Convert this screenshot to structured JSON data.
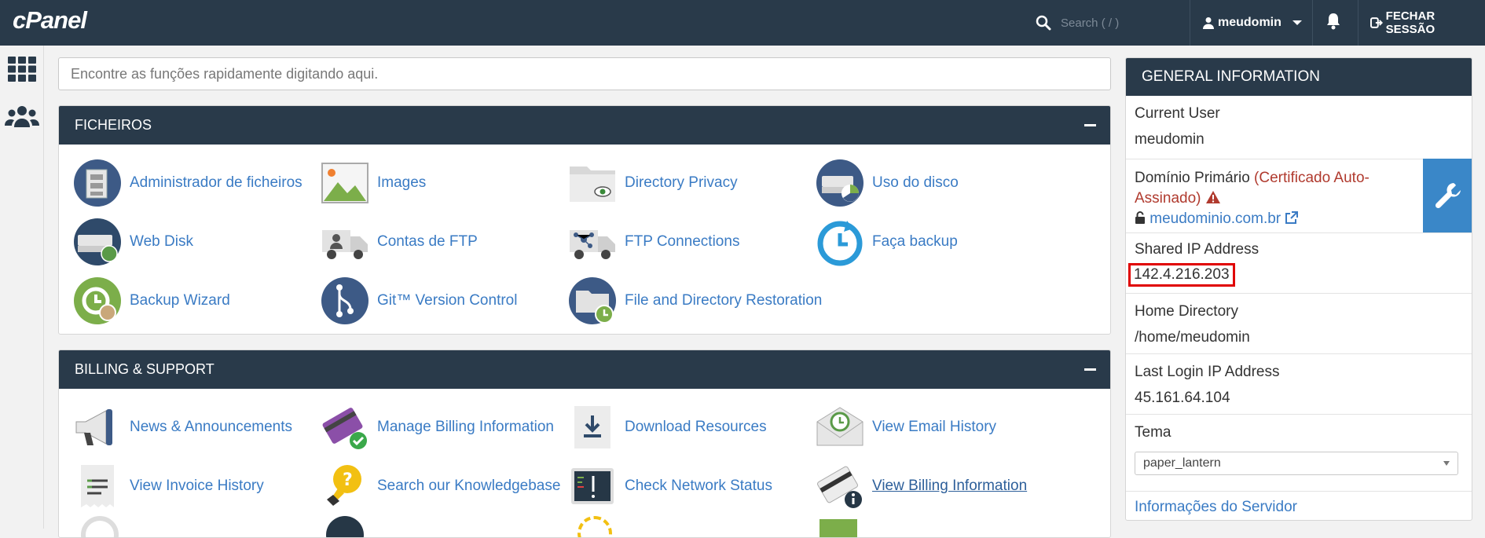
{
  "header": {
    "logo": "cPanel",
    "search_placeholder": "Search ( / )",
    "username": "meudomin",
    "logout": "FECHAR SESSÃO"
  },
  "quick_search": {
    "placeholder": "Encontre as funções rapidamente digitando aqui."
  },
  "panels": [
    {
      "title": "FICHEIROS",
      "items": [
        {
          "label": "Administrador de ficheiros",
          "icon": "file-manager-icon"
        },
        {
          "label": "Images",
          "icon": "images-icon"
        },
        {
          "label": "Directory Privacy",
          "icon": "directory-privacy-icon"
        },
        {
          "label": "Uso do disco",
          "icon": "disk-usage-icon"
        },
        {
          "label": "Web Disk",
          "icon": "web-disk-icon"
        },
        {
          "label": "Contas de FTP",
          "icon": "ftp-accounts-icon"
        },
        {
          "label": "FTP Connections",
          "icon": "ftp-connections-icon"
        },
        {
          "label": "Faça backup",
          "icon": "backup-icon"
        },
        {
          "label": "Backup Wizard",
          "icon": "backup-wizard-icon"
        },
        {
          "label": "Git™ Version Control",
          "icon": "git-icon"
        },
        {
          "label": "File and Directory Restoration",
          "icon": "restoration-icon"
        }
      ]
    },
    {
      "title": "BILLING & SUPPORT",
      "items": [
        {
          "label": "News & Announcements",
          "icon": "megaphone-icon"
        },
        {
          "label": "Manage Billing Information",
          "icon": "credit-card-icon"
        },
        {
          "label": "Download Resources",
          "icon": "download-icon"
        },
        {
          "label": "View Email History",
          "icon": "email-history-icon"
        },
        {
          "label": "View Invoice History",
          "icon": "invoice-icon"
        },
        {
          "label": "Search our Knowledgebase",
          "icon": "lightbulb-icon"
        },
        {
          "label": "Check Network Status",
          "icon": "network-status-icon"
        },
        {
          "label": "View Billing Information",
          "icon": "billing-info-icon"
        }
      ]
    }
  ],
  "general_info": {
    "title": "GENERAL INFORMATION",
    "current_user_label": "Current User",
    "current_user": "meudomin",
    "primary_domain_label": "Domínio Primário",
    "cert_note": "(Certificado Auto-Assinado)",
    "domain": "meudominio.com.br",
    "shared_ip_label": "Shared IP Address",
    "shared_ip": "142.4.216.203",
    "home_dir_label": "Home Directory",
    "home_dir": "/home/meudomin",
    "last_login_label": "Last Login IP Address",
    "last_login": "45.161.64.104",
    "theme_label": "Tema",
    "theme_value": "paper_lantern",
    "server_info": "Informações do Servidor"
  },
  "colors": {
    "navy": "#293a4a",
    "link": "#3a7bc4",
    "warning": "#b03a2e",
    "highlight": "#e00000"
  }
}
